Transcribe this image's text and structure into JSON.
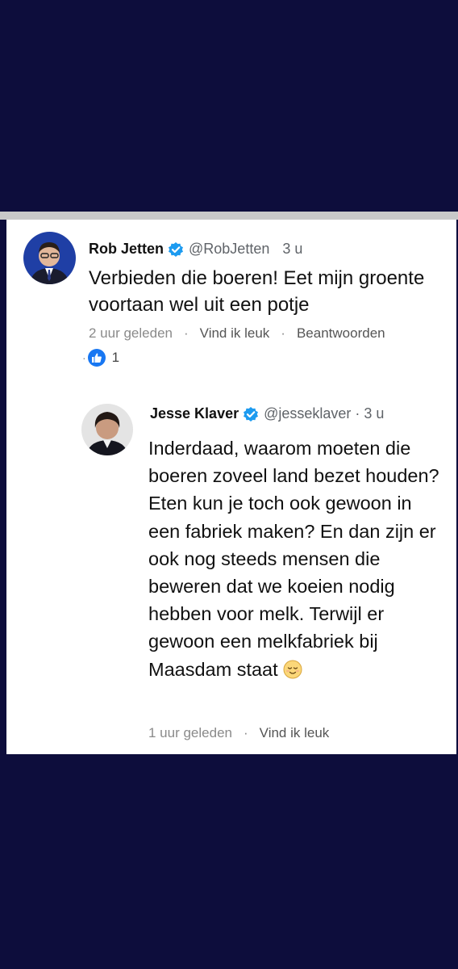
{
  "comments": [
    {
      "name": "Rob Jetten",
      "handle": "@RobJetten",
      "time": "3 u",
      "text": "Verbieden die boeren! Eet mijn groente voortaan wel uit een potje",
      "age": "2 uur geleden",
      "like_action": "Vind ik leuk",
      "reply_action": "Beantwoorden",
      "reaction_lead": "·",
      "reaction_count": "1",
      "reaction_icon": "thumbs-up-icon"
    },
    {
      "name": "Jesse Klaver",
      "handle": "@jesseklaver",
      "separator": "·",
      "time": "3 u",
      "text": "Inderdaad, waarom moeten die boeren zoveel land bezet houden? Eten kun je toch ook gewoon in een fabriek maken? En dan zijn er ook nog steeds mensen die beweren dat we koeien nodig hebben voor melk. Terwijl er gewoon een melkfabriek bij Maasdam staat",
      "emoji": "relieved-face-emoji",
      "age": "1 uur geleden",
      "like_action": "Vind ik leuk"
    }
  ],
  "meta_separator": "·",
  "colors": {
    "background": "#0d0d3c",
    "verified": "#1d9bf0",
    "like": "#1877f2"
  }
}
